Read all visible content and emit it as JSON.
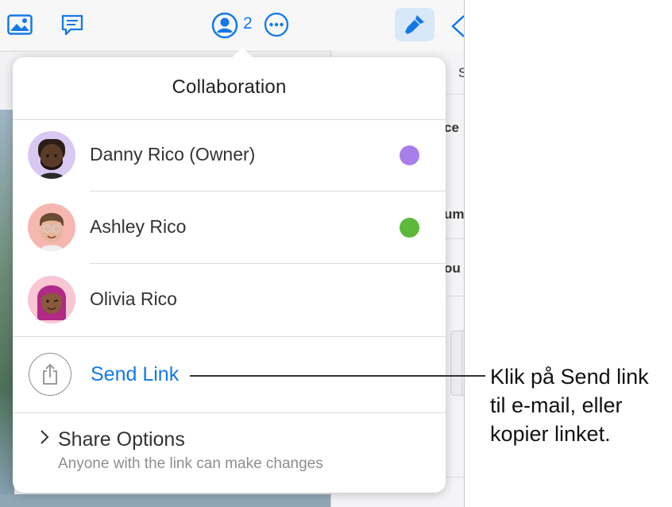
{
  "toolbar": {
    "icons": [
      "photo-icon",
      "comment-icon",
      "collaboration-icon",
      "more-icon",
      "format-icon",
      "back-icon"
    ],
    "collab_count": "2"
  },
  "side_panel": {
    "snippets": [
      "S",
      "ce",
      "um",
      "ou"
    ]
  },
  "popover": {
    "title": "Collaboration",
    "participants": [
      {
        "name": "Danny Rico (Owner)",
        "color": "#a87ee8",
        "avatar": "memoji-danny"
      },
      {
        "name": "Ashley Rico",
        "color": "#5cb93a",
        "avatar": "memoji-ashley"
      },
      {
        "name": "Olivia Rico",
        "color": null,
        "avatar": "memoji-olivia"
      }
    ],
    "send_link": {
      "label": "Send Link",
      "icon": "share-icon"
    },
    "share_options": {
      "label": "Share Options",
      "description": "Anyone with the link can make changes"
    }
  },
  "callout": {
    "text": "Klik på Send link til e-mail, eller kopier linket."
  },
  "colors": {
    "accent": "#1479e6"
  }
}
